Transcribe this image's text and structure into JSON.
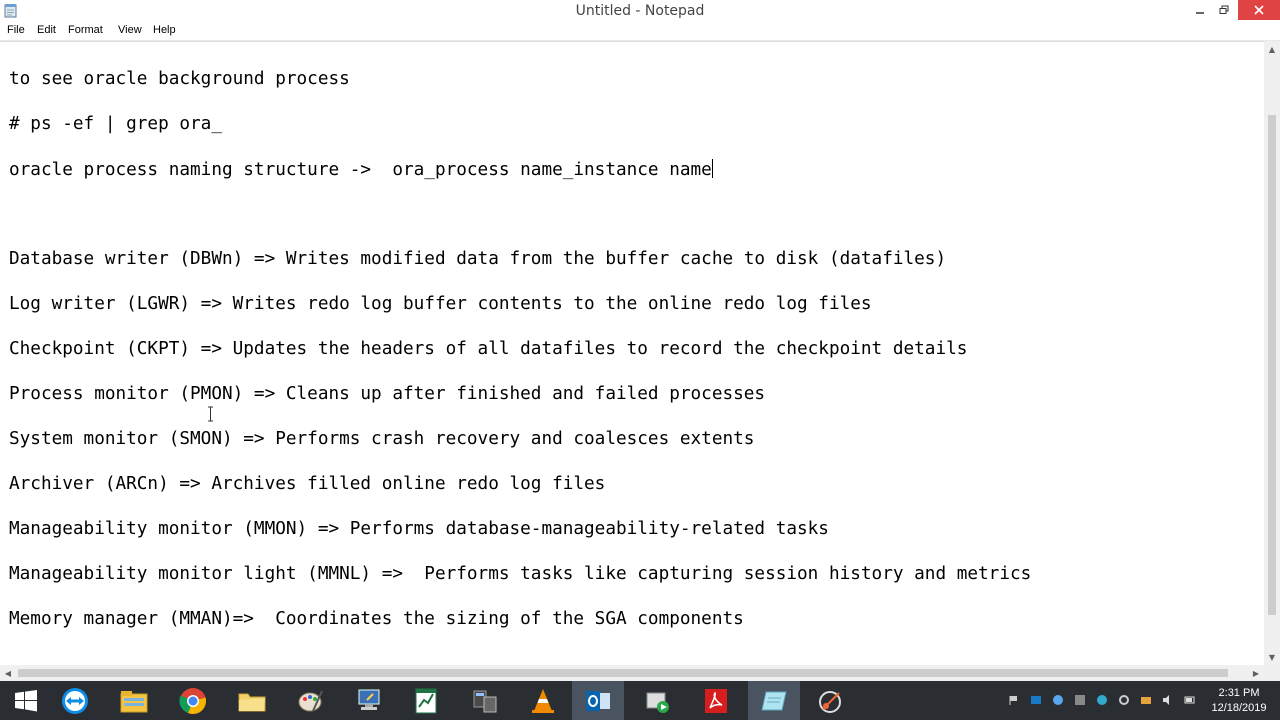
{
  "window": {
    "title": "Untitled - Notepad"
  },
  "menu": {
    "file": "File",
    "edit": "Edit",
    "format": "Format",
    "view": "View",
    "help": "Help"
  },
  "editor": {
    "lines": [
      "to see oracle background process",
      "# ps -ef | grep ora_",
      "oracle process naming structure ->  ora_process name_instance name",
      "Database writer (DBWn) => Writes modified data from the buffer cache to disk (datafiles)",
      "Log writer (LGWR) => Writes redo log buffer contents to the online redo log files",
      "Checkpoint (CKPT) => Updates the headers of all datafiles to record the checkpoint details",
      "Process monitor (PMON) => Cleans up after finished and failed processes",
      "System monitor (SMON) => Performs crash recovery and coalesces extents",
      "Archiver (ARCn) => Archives filled online redo log files",
      "Manageability monitor (MMON) => Performs database-manageability-related tasks",
      "Manageability monitor light (MMNL) =>  Performs tasks like capturing session history and metrics",
      "Memory manager (MMAN)=>  Coordinates the sizing of the SGA components"
    ]
  },
  "taskbar": {
    "apps": [
      {
        "icon": "teamviewer-icon"
      },
      {
        "icon": "file-explorer-icon"
      },
      {
        "icon": "chrome-icon"
      },
      {
        "icon": "folder-icon"
      },
      {
        "icon": "paint-icon"
      },
      {
        "icon": "remote-desktop-icon"
      },
      {
        "icon": "excel-chart-icon"
      },
      {
        "icon": "network-tool-icon"
      },
      {
        "icon": "vlc-icon"
      },
      {
        "icon": "outlook-icon"
      },
      {
        "icon": "media-center-icon"
      },
      {
        "icon": "acrobat-icon"
      },
      {
        "icon": "notepad-icon"
      },
      {
        "icon": "snipping-tool-icon"
      }
    ],
    "clock": {
      "time": "2:31 PM",
      "date": "12/18/2019"
    }
  },
  "colors": {
    "close_button": "#e04343",
    "taskbar": "#2a2e33",
    "active_task": "#4a5360"
  }
}
